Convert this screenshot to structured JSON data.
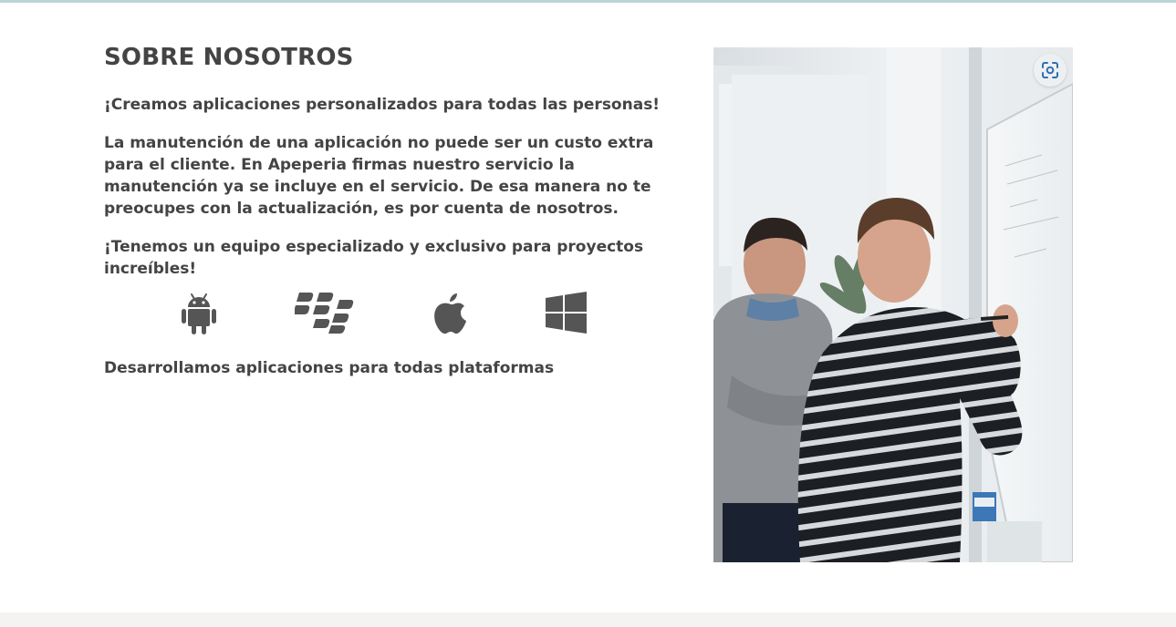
{
  "about": {
    "title": "SOBRE NOSOTROS",
    "paragraph_1": "¡Creamos aplicaciones personalizados para todas las personas!",
    "paragraph_2": "La manutención de una aplicación no puede ser un custo extra para el cliente. En Apeperia firmas nuestro servicio la manutención ya se incluye en el servicio. De esa manera no te preocupes con la actualización, es por cuenta de nosotros.",
    "paragraph_3": "¡Tenemos un equipo especializado y exclusivo para proyectos increíbles!",
    "platforms": [
      "android-icon",
      "blackberry-icon",
      "apple-icon",
      "windows-icon"
    ],
    "paragraph_4": "Desarrollamos aplicaciones para todas plataformas"
  },
  "photo": {
    "subject": "two men working at a whiteboard",
    "lens_icon": "visual-search-icon"
  },
  "colors": {
    "text": "#444444",
    "icon": "#555555",
    "top_rule": "#b9d6d6",
    "footer_band": "#f4f3f1",
    "lens_icon": "#2f6fb3"
  }
}
